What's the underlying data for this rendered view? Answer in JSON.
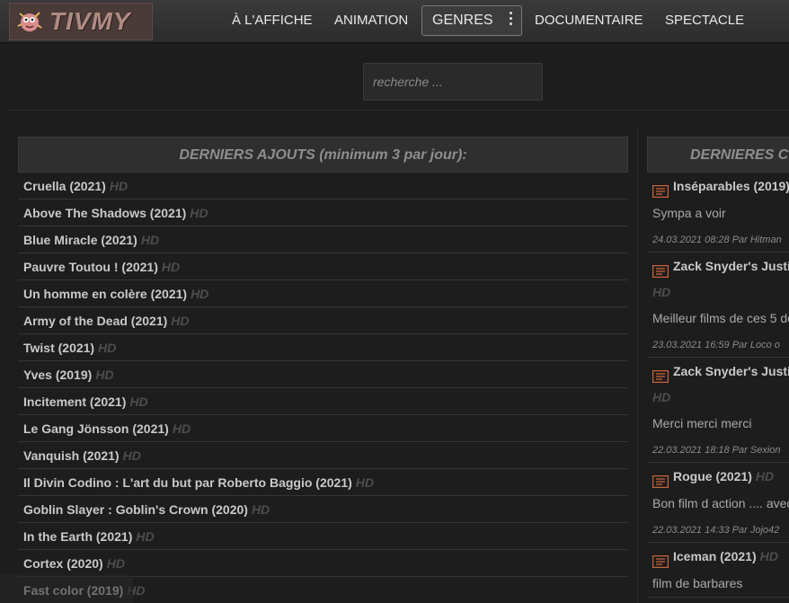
{
  "header": {
    "logo_text": "TIVMY",
    "nav": [
      "À L'AFFICHE",
      "ANIMATION",
      "GENRES",
      "DOCUMENTAIRE",
      "SPECTACLE"
    ]
  },
  "search": {
    "placeholder": "recherche ..."
  },
  "latest": {
    "title": "DERNIERS AJOUTS (minimum 3 par jour):",
    "hd_label": "HD",
    "items": [
      "Cruella (2021)",
      "Above The Shadows (2021)",
      "Blue Miracle (2021)",
      "Pauvre Toutou ! (2021)",
      "Un homme en colère (2021)",
      "Army of the Dead (2021)",
      "Twist (2021)",
      "Yves (2019)",
      "Incitement (2021)",
      "Le Gang Jönsson (2021)",
      "Vanquish (2021)",
      "Il Divin Codino : L'art du but par Roberto Baggio (2021)",
      "Goblin Slayer : Goblin's Crown (2020)",
      "In the Earth (2021)",
      "Cortex (2020)",
      "Fast color (2019)"
    ]
  },
  "comments": {
    "title": "DERNIERES C",
    "items": [
      {
        "title": "Inséparables (2019)",
        "hd_inline": "",
        "hd_line": "",
        "text": "Sympa a voir",
        "meta": "24.03.2021 08:28 Par Hitman"
      },
      {
        "title": "Zack Snyder's Justi",
        "hd_inline": "",
        "hd_line": "HD",
        "text": "Meilleur films de ces 5 de",
        "meta": "23.03.2021 16:59 Par Loco o"
      },
      {
        "title": "Zack Snyder's Justi",
        "hd_inline": "",
        "hd_line": "HD",
        "text": "Merci merci merci",
        "meta": "22.03.2021 18:18 Par Sexion"
      },
      {
        "title": "Rogue (2021)",
        "hd_inline": "HD",
        "hd_line": "",
        "text": "Bon film d action .... avec",
        "meta": "22.03.2021 14:33 Par Jojo42"
      },
      {
        "title": "Iceman (2021)",
        "hd_inline": "HD",
        "hd_line": "",
        "text": "film de barbares",
        "meta": ""
      }
    ]
  },
  "colors": {
    "accent_icon": "#c8643c",
    "hd": "#4d4d4d"
  }
}
